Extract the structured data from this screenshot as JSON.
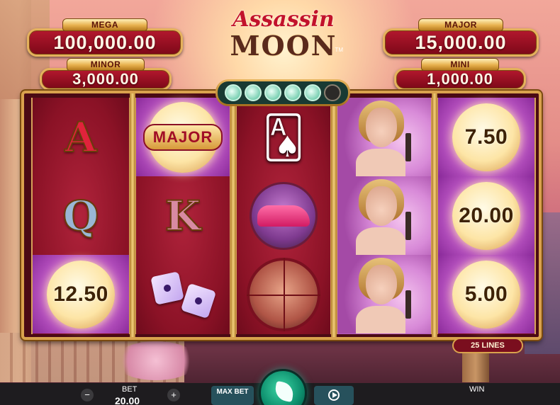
{
  "jackpots": {
    "mega": {
      "label": "MEGA",
      "value": "100,000.00"
    },
    "major": {
      "label": "MAJOR",
      "value": "15,000.00"
    },
    "minor": {
      "label": "MINOR",
      "value": "3,000.00"
    },
    "mini": {
      "label": "MINI",
      "value": "1,000.00"
    }
  },
  "logo": {
    "line1": "Assassin",
    "line2": "MOON",
    "tm": "TM"
  },
  "moon_progress": {
    "filled": 5,
    "total": 6
  },
  "reels": {
    "reel1": [
      "A",
      "Q",
      "12.50"
    ],
    "reel2": [
      "MAJOR",
      "K",
      "dice-icon"
    ],
    "reel3": [
      "cards-martini-icon",
      "car-icon",
      "villain-icon"
    ],
    "reel4": [
      "woman-icon",
      "woman-icon",
      "woman-icon"
    ],
    "reel5": [
      "7.50",
      "20.00",
      "5.00"
    ]
  },
  "lines_label": "25 LINES",
  "controls": {
    "minus": "−",
    "plus": "+",
    "bet_label": "BET",
    "bet_value": "20.00",
    "max_bet": "MAX BET",
    "win_label": "WIN"
  }
}
